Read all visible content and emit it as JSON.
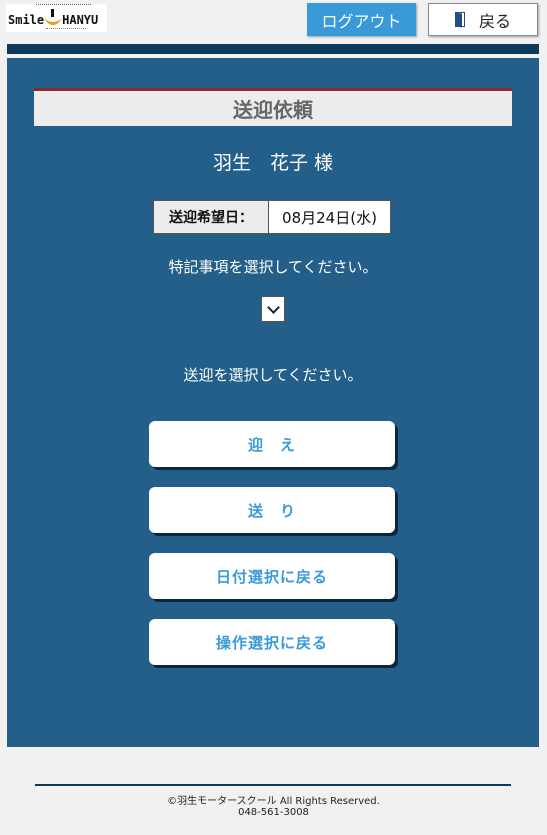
{
  "header": {
    "logo_text_left": "Smile",
    "logo_text_right": "HANYU",
    "logout_label": "ログアウト",
    "back_label": "戻る",
    "back_icon": "door-icon"
  },
  "main": {
    "title": "送迎依頼",
    "user_name": "羽生　花子 様",
    "date_label": "送迎希望日：",
    "date_value": "08月24日(水)",
    "note_prompt": "特記事項を選択してください。",
    "note_select_value": "",
    "pick_prompt": "送迎を選択してください。",
    "buttons": [
      {
        "label": "迎　え"
      },
      {
        "label": "送　り"
      },
      {
        "label": "日付選択に戻る"
      },
      {
        "label": "操作選択に戻る"
      }
    ]
  },
  "footer": {
    "copyright": "©羽生モータースクール All Rights Reserved.",
    "phone": "048-561-3008"
  },
  "colors": {
    "panel": "#235f89",
    "dark_bar": "#0e3a5c",
    "accent_blue": "#3a9ad9",
    "title_border": "#8a2a2a"
  }
}
